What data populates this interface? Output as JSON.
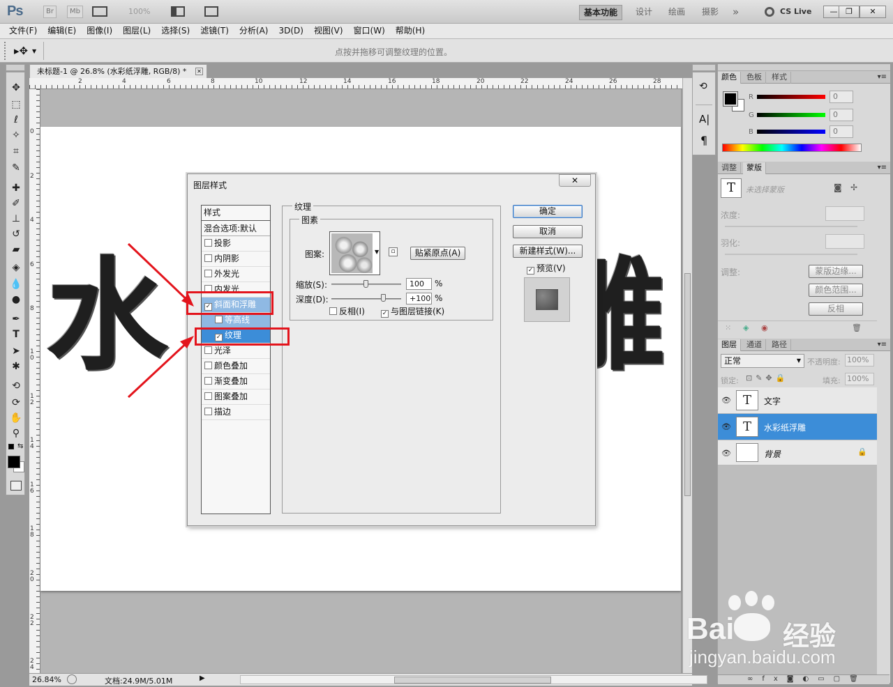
{
  "appbar": {
    "logo": "Ps",
    "bridge": "Br",
    "minibridge": "Mb",
    "zoom": "100%",
    "workspaces": [
      "基本功能",
      "设计",
      "绘画",
      "摄影"
    ],
    "more": "»",
    "cslive": "CS Live",
    "win_min": "—",
    "win_restore": "❐",
    "win_close": "✕"
  },
  "menu": [
    "文件(F)",
    "编辑(E)",
    "图像(I)",
    "图层(L)",
    "选择(S)",
    "滤镜(T)",
    "分析(A)",
    "3D(D)",
    "视图(V)",
    "窗口(W)",
    "帮助(H)"
  ],
  "options": {
    "hint": "点按并拖移可调整纹理的位置。"
  },
  "document": {
    "tab_title": "未标题-1 @ 26.8% (水彩纸浮雕, RGB/8) *",
    "canvas_text": [
      "水",
      "雕"
    ],
    "ruler_h": [
      "2",
      "4",
      "6",
      "8",
      "10",
      "12",
      "14",
      "16",
      "18",
      "20",
      "22",
      "24",
      "26",
      "28"
    ],
    "ruler_v": [
      "0",
      "2",
      "4",
      "6",
      "8",
      "1\n0",
      "1\n2",
      "1\n4",
      "1\n6",
      "1\n8",
      "2\n0",
      "2\n2",
      "2\n4"
    ]
  },
  "status": {
    "zoom": "26.84%",
    "doc": "文档:24.9M/5.01M"
  },
  "dialog": {
    "title": "图层样式",
    "close": "✕",
    "styles_header": "样式",
    "blend_default": "混合选项:默认",
    "items": [
      {
        "label": "投影",
        "checked": false
      },
      {
        "label": "内阴影",
        "checked": false
      },
      {
        "label": "外发光",
        "checked": false
      },
      {
        "label": "内发光",
        "checked": false
      },
      {
        "label": "斜面和浮雕",
        "checked": true
      },
      {
        "label": "等高线",
        "checked": false
      },
      {
        "label": "纹理",
        "checked": true
      },
      {
        "label": "光泽",
        "checked": false
      },
      {
        "label": "颜色叠加",
        "checked": false
      },
      {
        "label": "渐变叠加",
        "checked": false
      },
      {
        "label": "图案叠加",
        "checked": false
      },
      {
        "label": "描边",
        "checked": false
      }
    ],
    "texture_group": "纹理",
    "elements_group": "图素",
    "pattern_label": "图案:",
    "snap_button": "贴紧原点(A)",
    "scale_label": "缩放(S):",
    "scale_value": "100",
    "scale_unit": "%",
    "scale_pct": 50,
    "depth_label": "深度(D):",
    "depth_value": "+100",
    "depth_unit": "%",
    "depth_pct": 75,
    "invert_label": "反相(I)",
    "invert_checked": false,
    "link_label": "与图层链接(K)",
    "link_checked": true,
    "ok": "确定",
    "cancel": "取消",
    "new_style": "新建样式(W)...",
    "preview_label": "预览(V)",
    "preview_checked": true
  },
  "color_panel": {
    "tabs": [
      "颜色",
      "色板",
      "样式"
    ],
    "r": "R",
    "g": "G",
    "b": "B",
    "r_val": "0",
    "g_val": "0",
    "b_val": "0"
  },
  "mask_panel": {
    "tabs": [
      "调整",
      "蒙版"
    ],
    "no_mask": "未选择蒙版",
    "density": "浓度:",
    "feather": "羽化:",
    "adjust": "调整:",
    "btn_edge": "蒙版边缘...",
    "btn_range": "颜色范围...",
    "btn_invert": "反相"
  },
  "layers_panel": {
    "tabs": [
      "图层",
      "通道",
      "路径"
    ],
    "blend_mode": "正常",
    "opacity_label": "不透明度:",
    "opacity": "100%",
    "lock_label": "锁定:",
    "fill_label": "填充:",
    "fill": "100%",
    "layers": [
      {
        "name": "文字",
        "thumb": "T",
        "selected": false
      },
      {
        "name": "水彩纸浮雕",
        "thumb": "T",
        "selected": true
      },
      {
        "name": "背景",
        "thumb": "",
        "selected": false
      }
    ]
  },
  "watermark": {
    "brand": "Bai",
    "brand2": "经验",
    "url": "jingyan.baidu.com"
  },
  "colors": {
    "selection": "#3c8dd8",
    "annotation_red": "#e3141c"
  }
}
